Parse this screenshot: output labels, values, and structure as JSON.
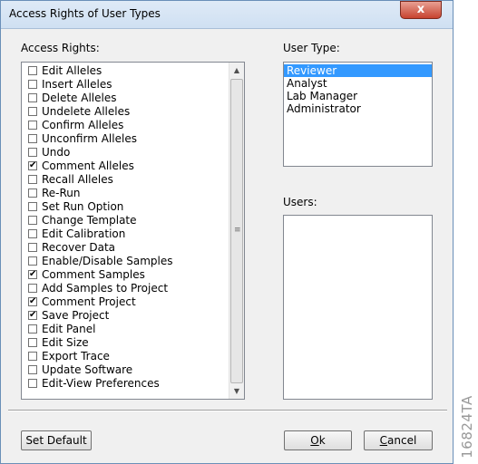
{
  "window": {
    "title": "Access Rights of User Types",
    "close_label": "x"
  },
  "access_rights": {
    "label": "Access Rights:",
    "items": [
      {
        "label": "Edit Alleles",
        "checked": false
      },
      {
        "label": "Insert Alleles",
        "checked": false
      },
      {
        "label": "Delete Alleles",
        "checked": false
      },
      {
        "label": "Undelete Alleles",
        "checked": false
      },
      {
        "label": "Confirm Alleles",
        "checked": false
      },
      {
        "label": "Unconfirm Alleles",
        "checked": false
      },
      {
        "label": "Undo",
        "checked": false
      },
      {
        "label": "Comment Alleles",
        "checked": true
      },
      {
        "label": "Recall Alleles",
        "checked": false
      },
      {
        "label": "Re-Run",
        "checked": false
      },
      {
        "label": "Set Run Option",
        "checked": false
      },
      {
        "label": "Change Template",
        "checked": false
      },
      {
        "label": "Edit Calibration",
        "checked": false
      },
      {
        "label": "Recover Data",
        "checked": false
      },
      {
        "label": "Enable/Disable Samples",
        "checked": false
      },
      {
        "label": "Comment Samples",
        "checked": true
      },
      {
        "label": "Add Samples to Project",
        "checked": false
      },
      {
        "label": "Comment Project",
        "checked": true
      },
      {
        "label": "Save Project",
        "checked": true
      },
      {
        "label": "Edit Panel",
        "checked": false
      },
      {
        "label": "Edit Size",
        "checked": false
      },
      {
        "label": "Export Trace",
        "checked": false
      },
      {
        "label": "Update Software",
        "checked": false
      },
      {
        "label": "Edit-View Preferences",
        "checked": false
      }
    ],
    "scroll_up": "▲",
    "scroll_down": "▼",
    "scroll_grip": "≡"
  },
  "user_type": {
    "label": "User Type:",
    "items": [
      {
        "label": "Reviewer",
        "selected": true
      },
      {
        "label": "Analyst",
        "selected": false
      },
      {
        "label": "Lab Manager",
        "selected": false
      },
      {
        "label": "Administrator",
        "selected": false
      }
    ]
  },
  "users": {
    "label": "Users:",
    "items": []
  },
  "buttons": {
    "set_default": "Set Default",
    "ok_mnemonic": "O",
    "ok_rest": "k",
    "cancel_mnemonic": "C",
    "cancel_rest": "ancel"
  },
  "side_label": "16824TA"
}
